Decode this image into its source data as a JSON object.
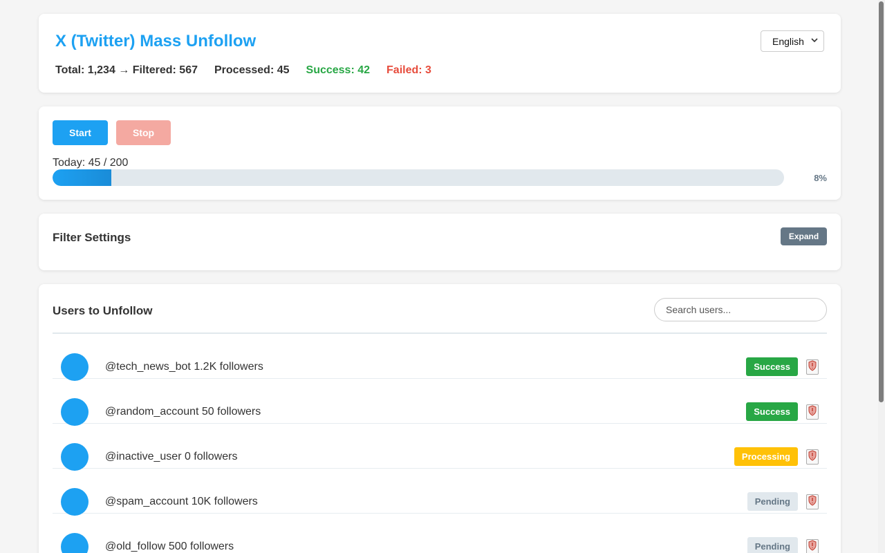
{
  "header": {
    "title": "X (Twitter) Mass Unfollow",
    "stats": {
      "total_filtered": "Total: 1,234 → Filtered: 567",
      "processed": "Processed: 45",
      "success": "Success: 42",
      "failed": "Failed: 3"
    },
    "language": "English"
  },
  "controls": {
    "start_label": "Start",
    "stop_label": "Stop",
    "today_label": "Today: 45 / 200",
    "progress_percent": 8,
    "progress_label": "8%"
  },
  "filter": {
    "title": "Filter Settings",
    "expand_label": "Expand"
  },
  "users": {
    "title": "Users to Unfollow",
    "search_placeholder": "Search users...",
    "items": [
      {
        "text": "@tech_news_bot 1.2K followers",
        "status": "Success",
        "kind": "success"
      },
      {
        "text": "@random_account 50 followers",
        "status": "Success",
        "kind": "success"
      },
      {
        "text": "@inactive_user 0 followers",
        "status": "Processing",
        "kind": "processing"
      },
      {
        "text": "@spam_account 10K followers",
        "status": "Pending",
        "kind": "pending"
      },
      {
        "text": "@old_follow 500 followers",
        "status": "Pending",
        "kind": "pending"
      }
    ]
  },
  "colors": {
    "accent": "#1da1f2",
    "success": "#28a745",
    "danger": "#e74c3c",
    "warning": "#ffc107",
    "muted": "#657786"
  },
  "icons": {
    "whitelist": "shield-icon",
    "language_dropdown": "chevron-down-icon"
  }
}
